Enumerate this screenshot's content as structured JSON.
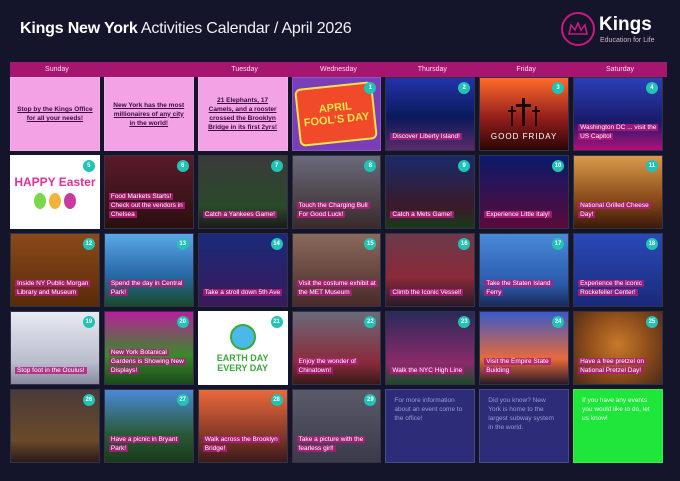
{
  "header": {
    "title_strong": "Kings New York",
    "title_light": "Activities Calendar / April 2026",
    "logo_name": "Kings",
    "logo_tagline": "Education for Life"
  },
  "weekdays": [
    "Sunday",
    "",
    "Tuesday",
    "Wednesday",
    "Thursday",
    "Friday",
    "Saturday"
  ],
  "facts": {
    "sunday": "Stop by the Kings Office for all your needs!",
    "monday": "New York has the most millionaires of any city in the world!",
    "tuesday": "21 Elephants, 17 Camels, and a rooster crossed the Brooklyn Bridge in its first 2yrs!"
  },
  "days": [
    {
      "num": "1",
      "caption": "",
      "label": "APRIL FOOL'S DAY"
    },
    {
      "num": "2",
      "caption": "Discover Liberty Island!"
    },
    {
      "num": "3",
      "caption": "",
      "label": "GOOD FRIDAY"
    },
    {
      "num": "4",
      "caption": "Washington DC ... visit the US Capitol"
    },
    {
      "num": "5",
      "caption": "",
      "label": "HAPPY Easter"
    },
    {
      "num": "6",
      "caption": "Food Markets Starts! Check out the vendors in Chelsea"
    },
    {
      "num": "7",
      "caption": "Catch a Yankees Game!"
    },
    {
      "num": "8",
      "caption": "Touch the Charging Bull For Good Luck!"
    },
    {
      "num": "9",
      "caption": "Catch a Mets Game!"
    },
    {
      "num": "10",
      "caption": "Experience Little Italy!"
    },
    {
      "num": "11",
      "caption": "National Grilled Cheese Day!"
    },
    {
      "num": "12",
      "caption": "Inside NY Public Morgan Library and Museum"
    },
    {
      "num": "13",
      "caption": "Spend the day in Central Park!"
    },
    {
      "num": "14",
      "caption": "Take a stroll down 5th Ave"
    },
    {
      "num": "15",
      "caption": "Visit the costume exhibit at the MET Museum"
    },
    {
      "num": "16",
      "caption": "Climb the Iconic Vessel!"
    },
    {
      "num": "17",
      "caption": "Take the Staten Island Ferry"
    },
    {
      "num": "18",
      "caption": "Experience the iconic Rockefeller Center!"
    },
    {
      "num": "19",
      "caption": "Stop foot in the Oculus!"
    },
    {
      "num": "20",
      "caption": "New York Botanical Gardens is Showing New Displays!"
    },
    {
      "num": "21",
      "caption": "",
      "label": "EARTH DAY EVERY DAY"
    },
    {
      "num": "22",
      "caption": "Enjoy the wonder of Chinatown!"
    },
    {
      "num": "23",
      "caption": "Walk the NYC High Line"
    },
    {
      "num": "24",
      "caption": "Visit the Empire State Building"
    },
    {
      "num": "25",
      "caption": "Have a free pretzel on National Pretzel Day!"
    },
    {
      "num": "26",
      "caption": ""
    },
    {
      "num": "27",
      "caption": "Have a picnic in Bryant Park!"
    },
    {
      "num": "28",
      "caption": "Walk across the Brooklyn Bridge!"
    },
    {
      "num": "29",
      "caption": "Take a picture with the fearless girl!"
    }
  ],
  "info": {
    "thursday": "For more information about an event come to the office!",
    "friday": "Did you know? New York is home to the largest subway system in the world.",
    "saturday": "If you have any events you would like to do, let us know!"
  },
  "colors": {
    "accent": "#a6156f",
    "pink_fact": "#f3a3e5",
    "badge": "#22c2b4",
    "info_dark": "#2c2c78",
    "info_green": "#1fe63a"
  }
}
